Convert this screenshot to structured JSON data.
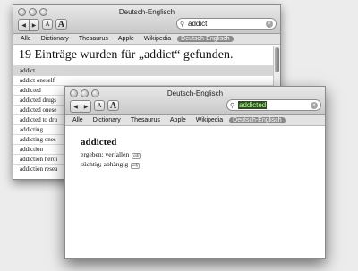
{
  "back_window": {
    "title": "Deutsch-Englisch",
    "search_query": "addict",
    "scopes": [
      "Alle",
      "Dictionary",
      "Thesaurus",
      "Apple",
      "Wikipedia",
      "Deutsch-Englisch"
    ],
    "results_heading": "19 Einträge wurden für „addict“ gefunden.",
    "results": [
      "addict",
      "addict oneself",
      "addicted",
      "addicted drugs",
      "addicted onese",
      "addicted to dru",
      "addicting",
      "addicting ones",
      "addiction",
      "addiction heroi",
      "addiction resea"
    ]
  },
  "front_window": {
    "title": "Deutsch-Englisch",
    "search_query": "addicted",
    "scopes": [
      "Alle",
      "Dictionary",
      "Thesaurus",
      "Apple",
      "Wikipedia",
      "Deutsch-Englisch"
    ],
    "entry": {
      "headword": "addicted",
      "line1": "ergeben; verfallen",
      "line1_tag": "adj",
      "line2": "süchtig; abhängig",
      "line2_tag": "adj"
    }
  },
  "toolbar": {
    "back_icon": "◀",
    "forward_icon": "▶",
    "font_smaller": "A",
    "font_larger": "A",
    "search_icon": "magnifier-icon",
    "clear_icon": "×"
  },
  "colors": {
    "selection_bg": "#2f4d23",
    "selection_fg": "#b4ff96",
    "active_scope": "#8a8a8a"
  }
}
